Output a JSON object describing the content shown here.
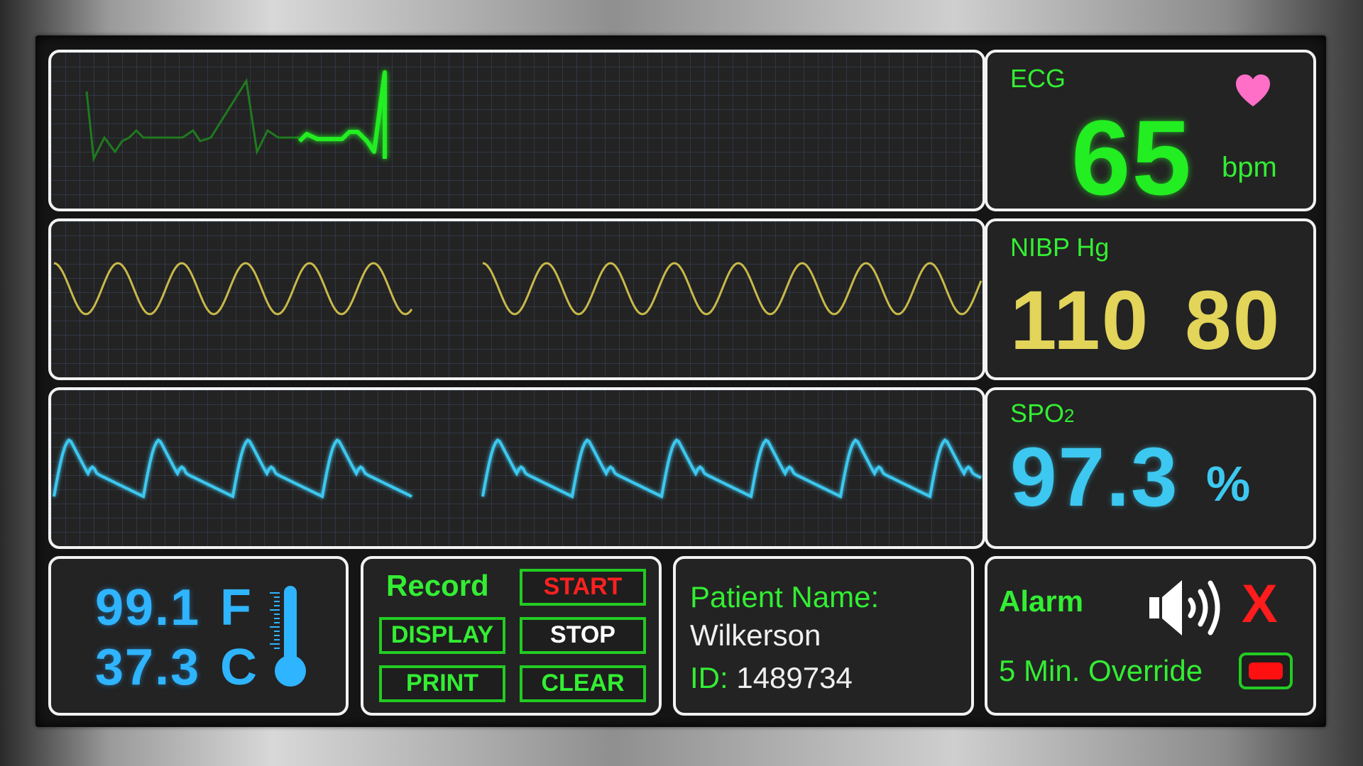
{
  "colors": {
    "ecg": "#22ee22",
    "nibp": "#e3d45a",
    "spo2": "#3cc8f0",
    "temp": "#2fb4ff",
    "alarm": "#ff1c1c",
    "border": "#f2f2f2"
  },
  "ecg": {
    "label": "ECG",
    "value": "65",
    "unit": "bpm",
    "icon": "heart-icon"
  },
  "nibp": {
    "label": "NIBP Hg",
    "systolic": "110",
    "diastolic": "80"
  },
  "spo2": {
    "label_main": "SPO",
    "label_sub": "2",
    "value": "97.3",
    "unit": "%"
  },
  "temperature": {
    "fahrenheit": "99.1",
    "f_unit": "F",
    "celsius": "37.3",
    "c_unit": "C",
    "icon": "thermometer-icon"
  },
  "record": {
    "title": "Record",
    "start": "START",
    "display": "DISPLAY",
    "stop": "STOP",
    "print": "PRINT",
    "clear": "CLEAR"
  },
  "patient": {
    "name_label": "Patient Name:",
    "name": "Wilkerson",
    "id_label": "ID:",
    "id": "1489734"
  },
  "alarm": {
    "title": "Alarm",
    "mute_symbol": "X",
    "override_label": "5 Min. Override",
    "icons": [
      "speaker-icon",
      "mute-x-icon",
      "override-toggle"
    ]
  }
}
